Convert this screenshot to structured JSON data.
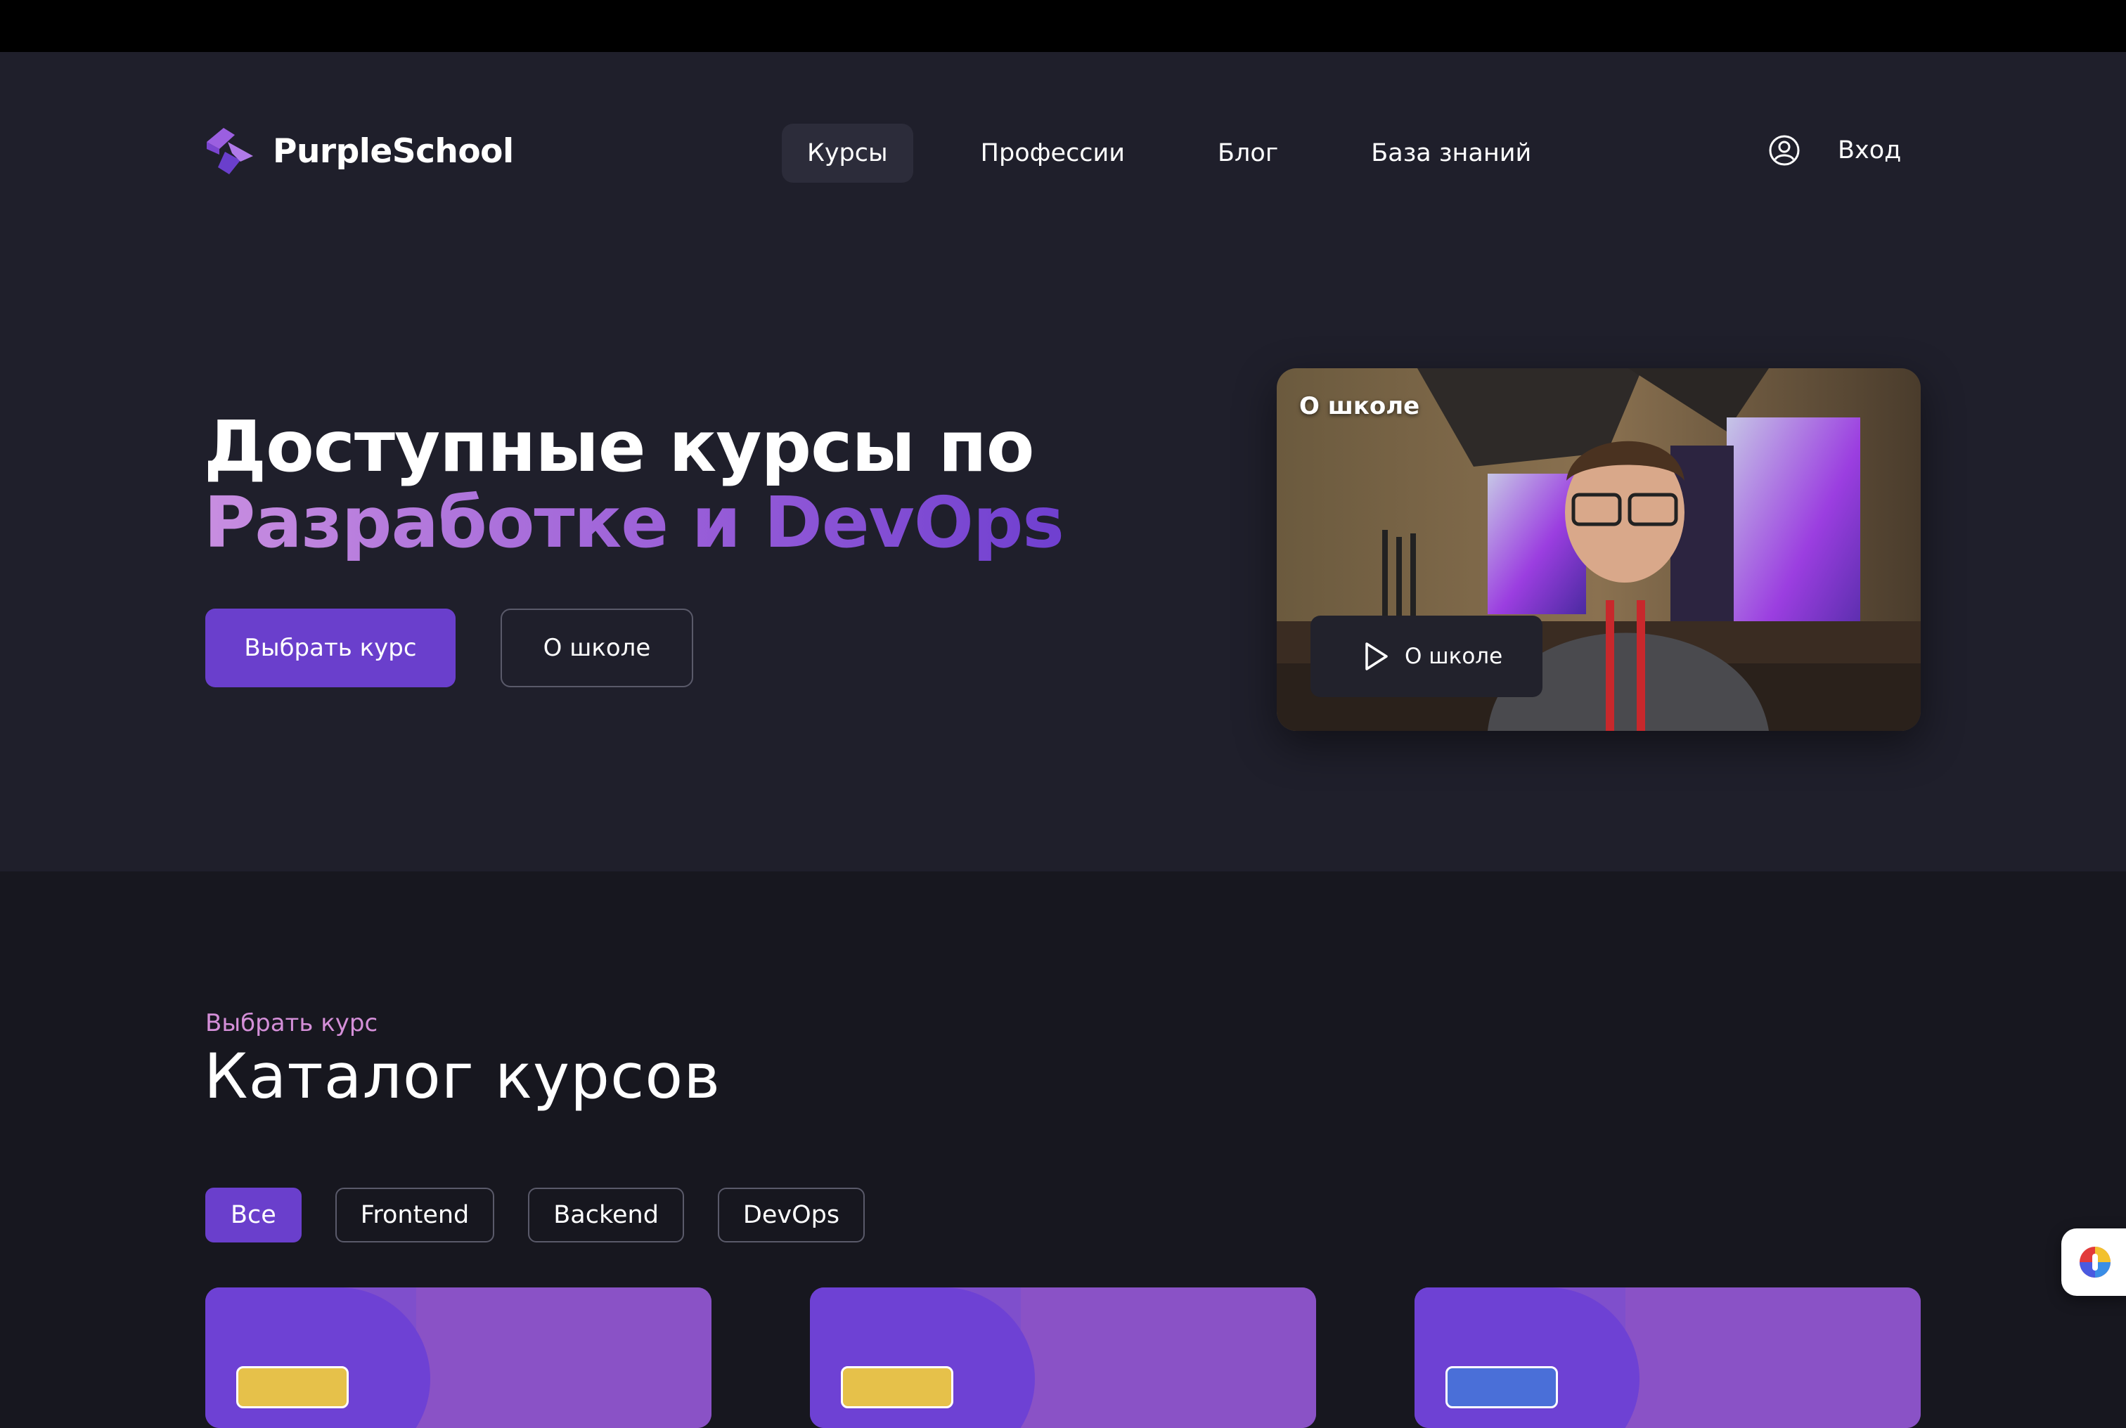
{
  "brand": {
    "name": "PurpleSchool",
    "accent": "#6a3fcc"
  },
  "nav": {
    "items": [
      {
        "label": "Курсы",
        "active": true
      },
      {
        "label": "Профессии",
        "active": false
      },
      {
        "label": "Блог",
        "active": false
      },
      {
        "label": "База знаний",
        "active": false
      }
    ],
    "login_label": "Вход",
    "login_icon": "user-circle-icon"
  },
  "hero": {
    "title_line1": "Доступные курсы по",
    "title_line2": "Разработке и DevOps",
    "primary_button": "Выбрать курс",
    "secondary_button": "О школе",
    "video": {
      "label": "О школе",
      "play_label": "О школе",
      "play_icon": "play-icon"
    }
  },
  "catalog": {
    "kicker": "Выбрать курс",
    "title": "Каталог курсов",
    "filters": [
      {
        "label": "Все",
        "active": true
      },
      {
        "label": "Frontend",
        "active": false
      },
      {
        "label": "Backend",
        "active": false
      },
      {
        "label": "DevOps",
        "active": false
      }
    ],
    "cards": [
      {
        "tag_color": "#e6c14a"
      },
      {
        "tag_color": "#e6c14a"
      },
      {
        "tag_color": "#4a6fd8"
      }
    ]
  },
  "helper_widget": {
    "icon": "assistant-icon"
  }
}
